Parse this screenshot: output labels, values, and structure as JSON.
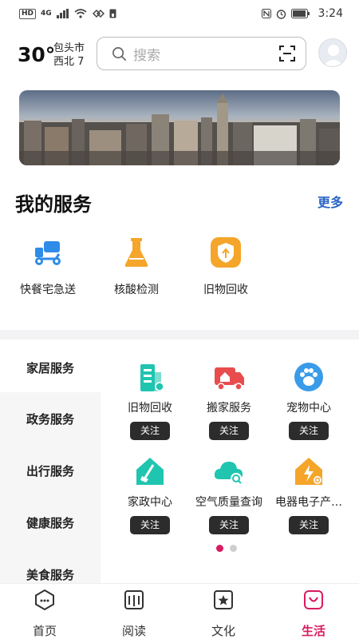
{
  "status_bar": {
    "tag_left": "HD",
    "network": "4G",
    "time": "3:24"
  },
  "header": {
    "temperature": "30°",
    "city": "包头市",
    "wind": "西北 7",
    "search_placeholder": "搜索"
  },
  "my_services": {
    "title": "我的服务",
    "more": "更多",
    "items": [
      {
        "label": "快餐宅急送",
        "icon": "delivery-scooter-icon"
      },
      {
        "label": "核酸检测",
        "icon": "test-tube-icon"
      },
      {
        "label": "旧物回收",
        "icon": "recycle-badge-icon"
      }
    ]
  },
  "categories": [
    "家居服务",
    "政务服务",
    "出行服务",
    "健康服务",
    "美食服务"
  ],
  "active_category": "家居服务",
  "grid": {
    "follow_label": "关注",
    "items": [
      {
        "label": "旧物回收",
        "icon": "building-icon",
        "color": "#20c5b0"
      },
      {
        "label": "搬家服务",
        "icon": "moving-truck-icon",
        "color": "#e84c4c"
      },
      {
        "label": "宠物中心",
        "icon": "paw-icon",
        "color": "#3a9be8"
      },
      {
        "label": "家政中心",
        "icon": "cleaning-house-icon",
        "color": "#20c5b0"
      },
      {
        "label": "空气质量查询",
        "icon": "cloud-search-icon",
        "color": "#20c5b0"
      },
      {
        "label": "电器电子产…",
        "icon": "power-house-icon",
        "color": "#f4a52a"
      }
    ]
  },
  "pager": {
    "pages": 2,
    "current": 1
  },
  "tabs": [
    {
      "label": "首页",
      "icon": "home-icon"
    },
    {
      "label": "阅读",
      "icon": "book-icon"
    },
    {
      "label": "文化",
      "icon": "culture-icon"
    },
    {
      "label": "生活",
      "icon": "life-icon"
    }
  ],
  "active_tab": "生活",
  "colors": {
    "accent": "#d81b60",
    "link": "#2a64c5",
    "button_dark": "#2c2c2c"
  }
}
